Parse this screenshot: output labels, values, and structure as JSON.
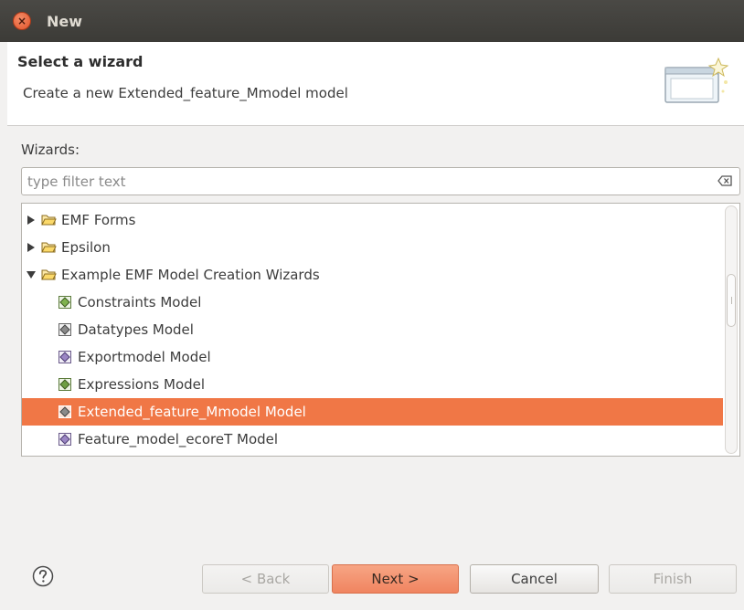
{
  "window": {
    "title": "New"
  },
  "header": {
    "title": "Select a wizard",
    "description": "Create a new Extended_feature_Mmodel model"
  },
  "wizards_label": "Wizards:",
  "filter": {
    "placeholder": "type filter text",
    "value": ""
  },
  "tree": {
    "items": [
      {
        "label": "EMF Forms",
        "type": "folder",
        "expanded": false
      },
      {
        "label": "Epsilon",
        "type": "folder",
        "expanded": false
      },
      {
        "label": "Example EMF Model Creation Wizards",
        "type": "folder",
        "expanded": true
      },
      {
        "label": "Constraints Model",
        "type": "model"
      },
      {
        "label": "Datatypes Model",
        "type": "model"
      },
      {
        "label": "Exportmodel Model",
        "type": "model"
      },
      {
        "label": "Expressions Model",
        "type": "model"
      },
      {
        "label": "Extended_feature_Mmodel Model",
        "type": "model",
        "selected": true
      },
      {
        "label": "Feature_model_ecoreT Model",
        "type": "model"
      }
    ]
  },
  "buttons": {
    "back": "< Back",
    "next": "Next >",
    "cancel": "Cancel",
    "finish": "Finish"
  },
  "colors": {
    "selection": "#f07746",
    "titlebar": "#3c3b37",
    "default_button": "#f08460"
  }
}
